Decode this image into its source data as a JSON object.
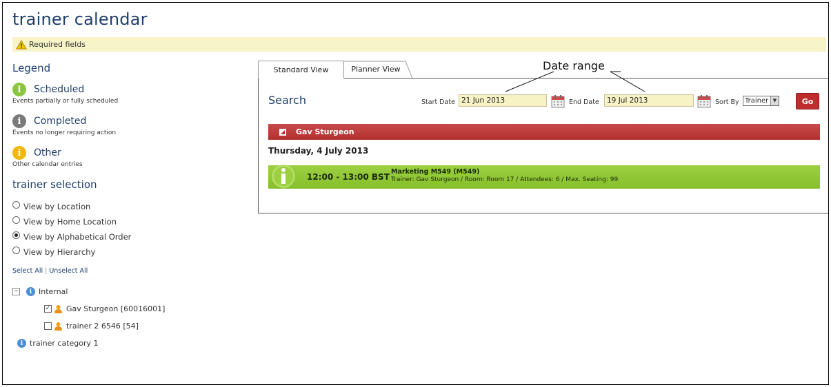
{
  "page": {
    "title": "trainer calendar",
    "required_text": "Required fields"
  },
  "legend": {
    "heading": "Legend",
    "items": [
      {
        "label": "Scheduled",
        "desc": "Events partially or fully scheduled",
        "color": "#8cc63f"
      },
      {
        "label": "Completed",
        "desc": "Events no longer requiring action",
        "color": "#7a7a7a"
      },
      {
        "label": "Other",
        "desc": "Other calendar entries",
        "color": "#f2b800"
      }
    ]
  },
  "trainer_selection": {
    "heading": "trainer selection",
    "options": [
      {
        "label": "View by Location",
        "selected": false
      },
      {
        "label": "View by Home Location",
        "selected": false
      },
      {
        "label": "View by Alphabetical Order",
        "selected": true
      },
      {
        "label": "View by Hierarchy",
        "selected": false
      }
    ],
    "select_all": "Select All",
    "unselect_all": "Unselect All",
    "separator": "|"
  },
  "tree": {
    "group": "Internal",
    "trainers": [
      {
        "label": "Gav Sturgeon [60016001]",
        "checked": true
      },
      {
        "label": "trainer 2 6546 [54]",
        "checked": false
      }
    ],
    "category": "trainer category 1"
  },
  "tabs": {
    "standard": "Standard View",
    "planner": "Planner View"
  },
  "search": {
    "title": "Search",
    "start_label": "Start Date",
    "start_value": "21 Jun 2013",
    "end_label": "End Date",
    "end_value": "19 Jul 2013",
    "sort_label": "Sort By",
    "sort_value": "Trainer",
    "go": "Go"
  },
  "results": {
    "group": "Gav Sturgeon",
    "day": "Thursday, 4 July 2013",
    "event": {
      "time": "12:00 - 13:00 BST",
      "title": "Marketing M549 (M549)",
      "details": "Trainer: Gav Sturgeon / Room: Room 17 / Attendees: 6 / Max. Seating: 99"
    }
  },
  "annotation": {
    "text": "Date range"
  },
  "colors": {
    "title": "#1f3f6e",
    "required_bar": "#f7f4c8",
    "group_bar": "#b32f2f",
    "event_bar": "#8cc63f",
    "go_button": "#bf2e2e"
  }
}
